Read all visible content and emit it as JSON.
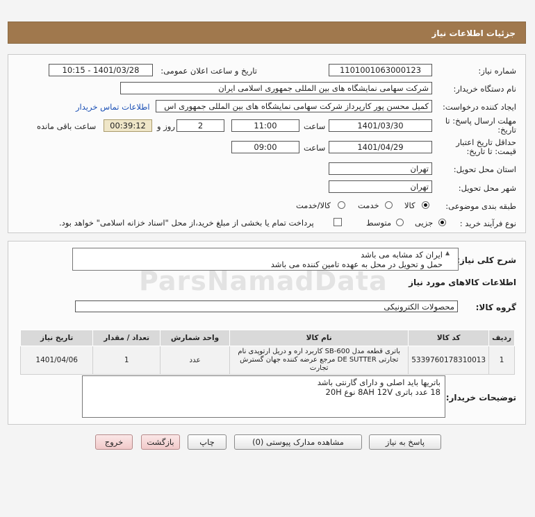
{
  "header": {
    "title": "جزئیات اطلاعات نیاز"
  },
  "form": {
    "need_number_label": "شماره نیاز:",
    "need_number": "1101001063000123",
    "announce_label": "تاریخ و ساعت اعلان عمومی:",
    "announce_value": "1401/03/28 - 10:15",
    "buyer_label": "نام دستگاه خریدار:",
    "buyer_value": "شرکت سهامی نمایشگاه های بین المللی جمهوری اسلامی ایران",
    "creator_label": "ایجاد کننده درخواست:",
    "creator_value": "کمیل محسن پور کارپرداز شرکت سهامی نمایشگاه های بین المللی جمهوری اس",
    "contact_link": "اطلاعات تماس خریدار",
    "deadline_label_1": "مهلت ارسال پاسخ: تا",
    "deadline_label_2": "تاریخ:",
    "deadline_date": "1401/03/30",
    "time_word": "ساعت",
    "deadline_time": "11:00",
    "days_value": "2",
    "days_word": "روز و",
    "remaining_time": "00:39:12",
    "remaining_label": "ساعت باقی مانده",
    "validity_label_1": "حداقل تاریخ اعتبار",
    "validity_label_2": "قیمت: تا تاریخ:",
    "validity_date": "1401/04/29",
    "validity_time": "09:00",
    "province_label": "استان محل تحویل:",
    "province_value": "تهران",
    "city_label": "شهر محل تحویل:",
    "city_value": "تهران",
    "category_label": "طبقه بندی موضوعی:",
    "category_options": [
      "کالا",
      "خدمت",
      "کالا/خدمت"
    ],
    "process_label": "نوع فرآیند خرید :",
    "process_options": [
      "جزیی",
      "متوسط"
    ],
    "payment_note": "پرداخت تمام یا بخشی از مبلغ خرید،از محل \"اسناد خزانه اسلامی\" خواهد بود."
  },
  "summary": {
    "label": "شرح کلی نیاز:",
    "line1": "ایران کد مشابه می باشد",
    "line2": "حمل و تحویل در محل به عهده تامین کننده می باشد"
  },
  "goods": {
    "section_title": "اطلاعات کالاهای مورد نیاز",
    "group_label": "گروه کالا:",
    "group_value": "محصولات الکترونیکی",
    "columns": [
      "ردیف",
      "کد کالا",
      "نام کالا",
      "واحد شمارش",
      "تعداد / مقدار",
      "تاریخ نیاز"
    ],
    "rows": [
      {
        "row": "1",
        "code": "5339760178310013",
        "name": "باتری قطعه مدل SB-600 کاربرد اره و دریل ارتوپدی نام تجارتی DE SUTTER مرجع عرضه کننده جهان گسترش تجارت",
        "unit": "عدد",
        "qty": "1",
        "date": "1401/04/06"
      }
    ]
  },
  "buyer_notes": {
    "label": "توضیحات خریدار:",
    "line1": "باتریها باید اصلی و دارای گارنتی باشد",
    "line2": "18 عدد باتری 8AH   12V نوع 20H"
  },
  "buttons": {
    "reply": "پاسخ به نیاز",
    "view_docs": "مشاهده مدارک پیوستی (0)",
    "print": "چاپ",
    "back": "بازگشت",
    "exit": "خروج"
  },
  "watermark": "ParsNamadData"
}
